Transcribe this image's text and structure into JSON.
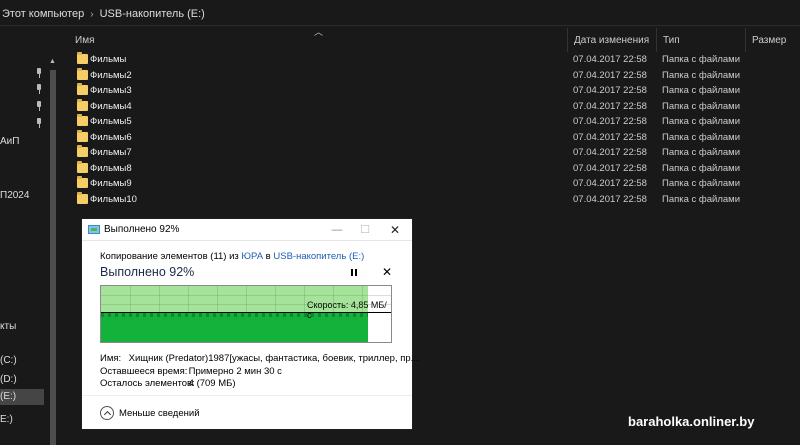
{
  "breadcrumb": {
    "root": "Этот компьютер",
    "current": "USB-накопитель (E:)"
  },
  "nav": {
    "items": [
      "АиП",
      "П2024",
      "кты",
      "(C:)",
      "(D:)",
      "(E:)",
      "E:)"
    ]
  },
  "columns": {
    "name": "Имя",
    "date": "Дата изменения",
    "type": "Тип",
    "size": "Размер"
  },
  "files": [
    {
      "name": "Фильмы",
      "date": "07.04.2017 22:58",
      "type": "Папка с файлами"
    },
    {
      "name": "Фильмы2",
      "date": "07.04.2017 22:58",
      "type": "Папка с файлами"
    },
    {
      "name": "Фильмы3",
      "date": "07.04.2017 22:58",
      "type": "Папка с файлами"
    },
    {
      "name": "Фильмы4",
      "date": "07.04.2017 22:58",
      "type": "Папка с файлами"
    },
    {
      "name": "Фильмы5",
      "date": "07.04.2017 22:58",
      "type": "Папка с файлами"
    },
    {
      "name": "Фильмы6",
      "date": "07.04.2017 22:58",
      "type": "Папка с файлами"
    },
    {
      "name": "Фильмы7",
      "date": "07.04.2017 22:58",
      "type": "Папка с файлами"
    },
    {
      "name": "Фильмы8",
      "date": "07.04.2017 22:58",
      "type": "Папка с файлами"
    },
    {
      "name": "Фильмы9",
      "date": "07.04.2017 22:58",
      "type": "Папка с файлами"
    },
    {
      "name": "Фильмы10",
      "date": "07.04.2017 22:58",
      "type": "Папка с файлами"
    }
  ],
  "dialog": {
    "title": "Выполнено 92%",
    "copy_prefix": "Копирование элементов (11) из ",
    "copy_source": "ЮРА",
    "copy_mid": " в ",
    "copy_dest": "USB-накопитель (E:)",
    "heading": "Выполнено 92%",
    "progress_percent": 92,
    "speed": "Скорость: 4,85 МБ/с",
    "name_label": "Имя:",
    "name_value": "Хищник (Predator)1987[ужасы, фантастика, боевик, триллер, пр...",
    "time_label": "Оставшееся время:",
    "time_value": "Примерно 2 мин 30 с",
    "items_label": "Осталось элементов:",
    "items_value": "4 (709 МБ)",
    "less_details": "Меньше сведений"
  },
  "watermark": "baraholka.onliner.by",
  "icons": {
    "folder": "folder-icon",
    "pin": "pin-icon",
    "app": "copy-app-icon"
  },
  "colors": {
    "progress_light": "#a5e39a",
    "progress_dark": "#14b23a",
    "link": "#1e5fb4",
    "folder": "#f5cf66"
  }
}
